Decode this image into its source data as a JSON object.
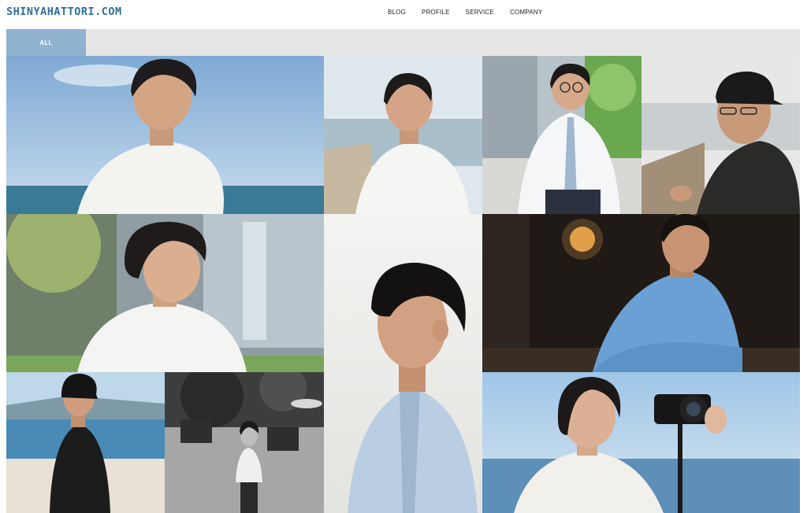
{
  "header": {
    "logo": "SHINYAHATTORI.COM",
    "nav": [
      {
        "label": "BLOG"
      },
      {
        "label": "PROFILE"
      },
      {
        "label": "SERVICE"
      },
      {
        "label": "COMPANY"
      }
    ]
  },
  "filters": {
    "active": "ALL"
  },
  "colors": {
    "brand": "#2f6f9a",
    "filter_active": "#8fb2cf",
    "filter_bar": "#e6e6e6"
  },
  "gallery": {
    "photos": [
      {
        "id": "portrait-beach-white-tee"
      },
      {
        "id": "portrait-smiling-seaside"
      },
      {
        "id": "portrait-glasses-tie"
      },
      {
        "id": "portrait-cap-glasses"
      },
      {
        "id": "portrait-curly-hair-outdoor"
      },
      {
        "id": "portrait-profile-light-shirt"
      },
      {
        "id": "portrait-blue-shirt-dark-room"
      },
      {
        "id": "portrait-beach-black-outfit"
      },
      {
        "id": "portrait-black-white-courtyard"
      },
      {
        "id": "portrait-woman-camera"
      }
    ]
  }
}
